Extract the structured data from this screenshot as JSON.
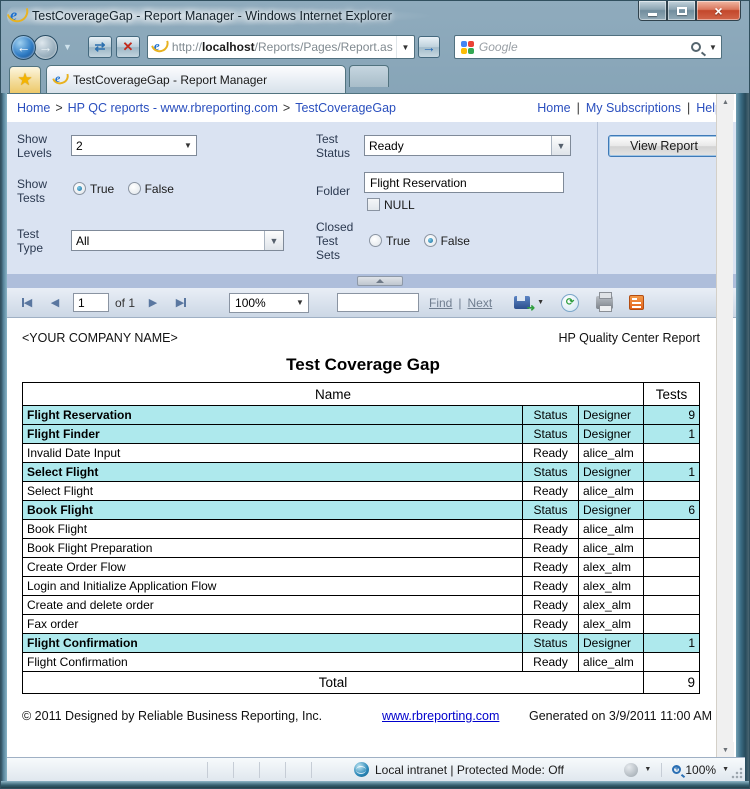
{
  "window": {
    "title": "TestCoverageGap - Report Manager - Windows Internet Explorer",
    "address_prefix": "http://",
    "address_host": "localhost",
    "address_path": "/Reports/Pages/Report.as",
    "search_placeholder": "Google",
    "tab_label": "TestCoverageGap - Report Manager"
  },
  "breadcrumb": {
    "items": [
      "Home",
      "HP QC reports - www.rbreporting.com",
      "TestCoverageGap"
    ],
    "separator": ">",
    "links_right": [
      "Home",
      "My Subscriptions",
      "Help"
    ]
  },
  "parameters": {
    "show_levels_label": "Show\nLevels",
    "show_levels_value": "2",
    "show_tests_label": "Show\nTests",
    "show_tests_true": "True",
    "show_tests_false": "False",
    "test_type_label": "Test\nType",
    "test_type_value": "All",
    "test_status_label": "Test\nStatus",
    "test_status_value": "Ready",
    "folder_label": "Folder",
    "folder_value": "Flight Reservation",
    "null_label": "NULL",
    "closed_label": "Closed\nTest\nSets",
    "closed_true": "True",
    "closed_false": "False",
    "view_report_label": "View Report"
  },
  "toolbar": {
    "page_value": "1",
    "of_pages": "of 1",
    "zoom_value": "100%",
    "find_label": "Find",
    "next_label": "Next"
  },
  "report": {
    "company": "<YOUR COMPANY NAME>",
    "report_type": "HP Quality Center Report",
    "title": "Test Coverage Gap",
    "col_name": "Name",
    "col_tests": "Tests",
    "rows": [
      {
        "type": "group",
        "indent": 0,
        "name": "Flight Reservation",
        "status": "Status",
        "designer": "Designer",
        "tests": "9"
      },
      {
        "type": "group",
        "indent": 1,
        "name": "Flight Finder",
        "status": "Status",
        "designer": "Designer",
        "tests": "1"
      },
      {
        "type": "test",
        "indent": 2,
        "name": "Invalid Date Input",
        "status": "Ready",
        "designer": "alice_alm",
        "tests": ""
      },
      {
        "type": "group",
        "indent": 1,
        "name": "Select Flight",
        "status": "Status",
        "designer": "Designer",
        "tests": "1"
      },
      {
        "type": "test",
        "indent": 2,
        "name": "Select Flight",
        "status": "Ready",
        "designer": "alice_alm",
        "tests": ""
      },
      {
        "type": "group",
        "indent": 1,
        "name": "Book Flight",
        "status": "Status",
        "designer": "Designer",
        "tests": "6"
      },
      {
        "type": "test",
        "indent": 2,
        "name": "Book Flight",
        "status": "Ready",
        "designer": "alice_alm",
        "tests": ""
      },
      {
        "type": "test",
        "indent": 2,
        "name": "Book Flight Preparation",
        "status": "Ready",
        "designer": "alice_alm",
        "tests": ""
      },
      {
        "type": "test",
        "indent": 2,
        "name": "Create Order Flow",
        "status": "Ready",
        "designer": "alex_alm",
        "tests": ""
      },
      {
        "type": "test",
        "indent": 2,
        "name": "Login and Initialize Application Flow",
        "status": "Ready",
        "designer": "alex_alm",
        "tests": ""
      },
      {
        "type": "test",
        "indent": 2,
        "name": "Create and delete order",
        "status": "Ready",
        "designer": "alex_alm",
        "tests": ""
      },
      {
        "type": "test",
        "indent": 2,
        "name": "Fax order",
        "status": "Ready",
        "designer": "alex_alm",
        "tests": ""
      },
      {
        "type": "group",
        "indent": 1,
        "name": "Flight Confirmation",
        "status": "Status",
        "designer": "Designer",
        "tests": "1"
      },
      {
        "type": "test",
        "indent": 2,
        "name": "Flight Confirmation",
        "status": "Ready",
        "designer": "alice_alm",
        "tests": ""
      }
    ],
    "total_label": "Total",
    "total_tests": "9",
    "footer_copyright": "© 2011 Designed by Reliable Business Reporting, Inc.",
    "footer_link": "www.rbreporting.com",
    "footer_generated": "Generated on 3/9/2011 11:00 AM"
  },
  "statusbar": {
    "zone_text": "Local intranet | Protected Mode: Off",
    "zoom_value": "100%"
  },
  "colors": {
    "group_row_bg": "#aee9ed",
    "chrome": "#6f91a6",
    "param_bg": "#dae3f2",
    "link_blue": "#2a4fbe",
    "feed_orange": "#e2621b"
  }
}
